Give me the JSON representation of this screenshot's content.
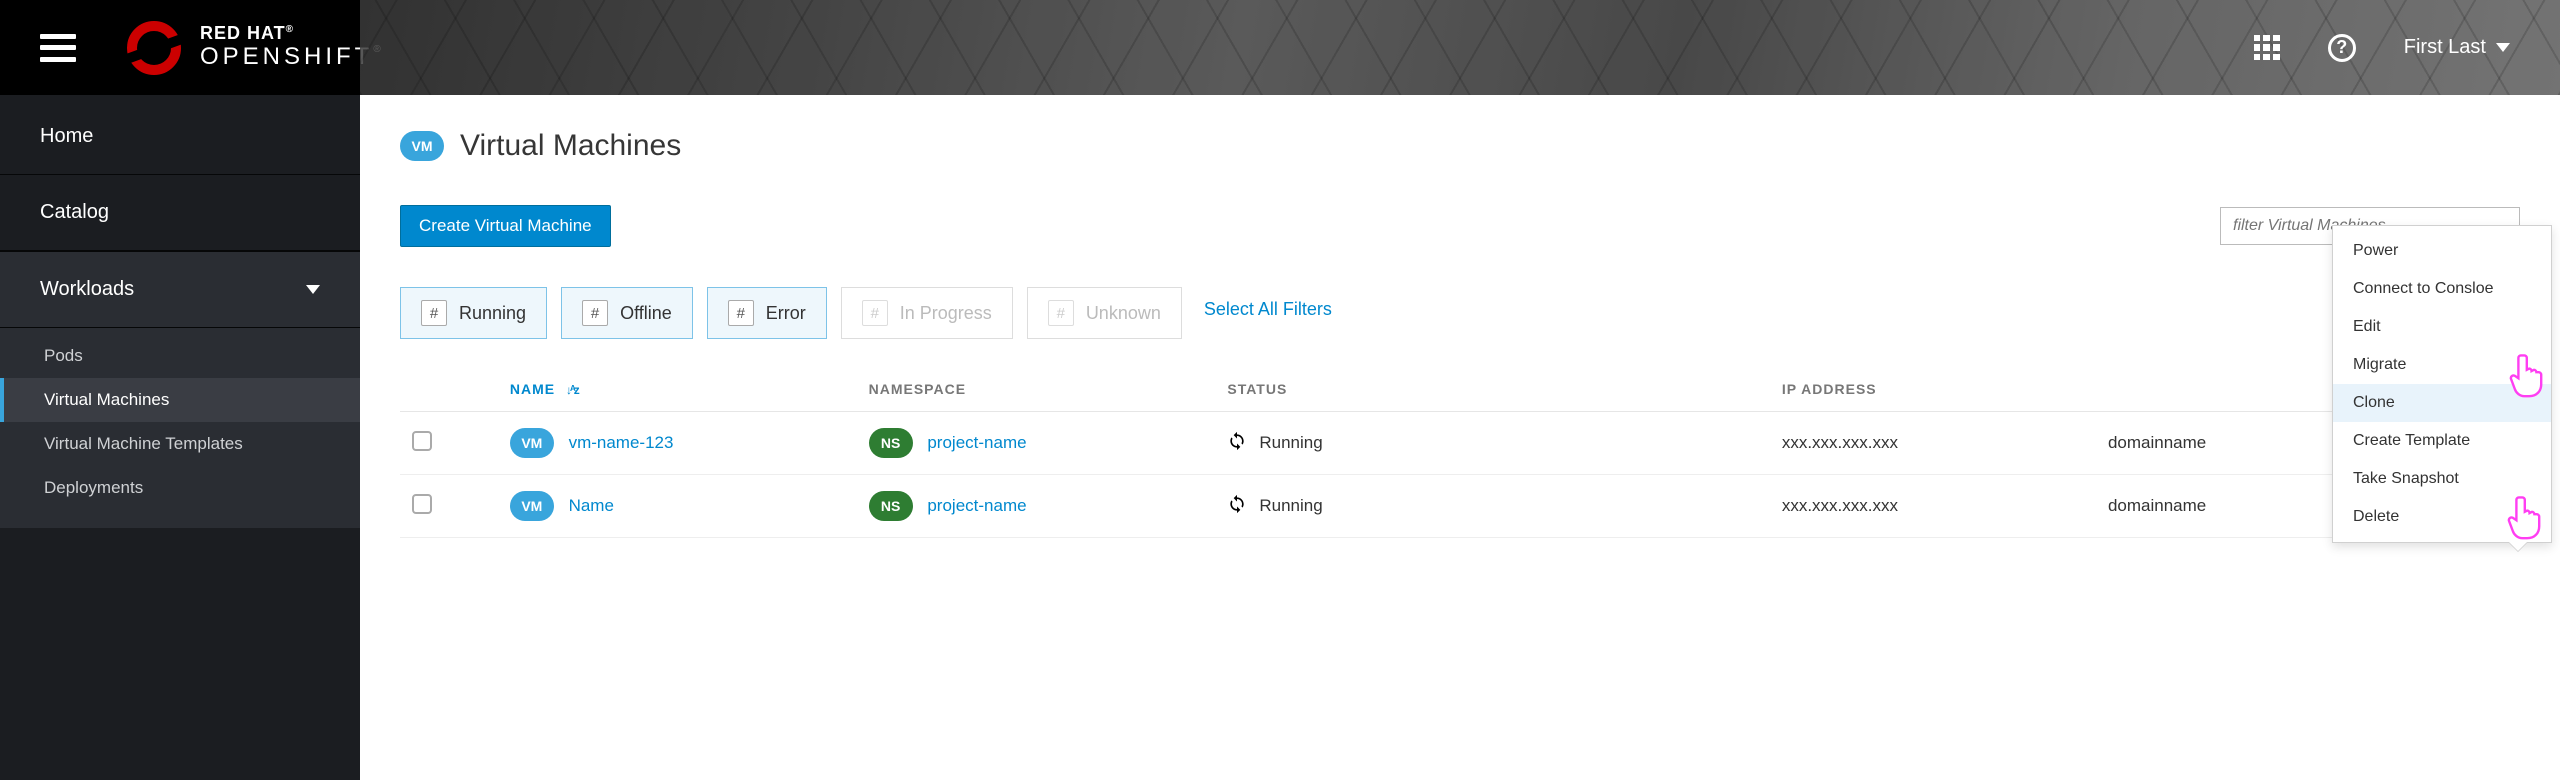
{
  "brand": {
    "line1": "RED HAT",
    "line2": "OPENSHIFT"
  },
  "topbar": {
    "user_name": "First Last"
  },
  "sidebar": {
    "items": [
      {
        "label": "Home"
      },
      {
        "label": "Catalog"
      }
    ],
    "group": {
      "label": "Workloads"
    },
    "sub_items": [
      {
        "label": "Pods"
      },
      {
        "label": "Virtual Machines"
      },
      {
        "label": "Virtual Machine Templates"
      },
      {
        "label": "Deployments"
      }
    ]
  },
  "page": {
    "badge": "VM",
    "title": "Virtual Machines",
    "create_button": "Create Virtual Machine",
    "filter_placeholder": "filter Virtual Machines"
  },
  "filters": {
    "chips": [
      {
        "count": "#",
        "label": "Running"
      },
      {
        "count": "#",
        "label": "Offline"
      },
      {
        "count": "#",
        "label": "Error"
      },
      {
        "count": "#",
        "label": "In Progress"
      },
      {
        "count": "#",
        "label": "Unknown"
      }
    ],
    "select_all": "Select All Filters"
  },
  "table": {
    "headers": {
      "name": "NAME",
      "namespace": "NAMESPACE",
      "status": "STATUS",
      "ip": "IP ADDRESS",
      "domain": ""
    },
    "rows": [
      {
        "vm_badge": "VM",
        "name": "vm-name-123",
        "ns_badge": "NS",
        "namespace": "project-name",
        "status": "Running",
        "ip": "xxx.xxx.xxx.xxx",
        "domain": "domainname"
      },
      {
        "vm_badge": "VM",
        "name": "Name",
        "ns_badge": "NS",
        "namespace": "project-name",
        "status": "Running",
        "ip": "xxx.xxx.xxx.xxx",
        "domain": "domainname"
      }
    ]
  },
  "context_menu": {
    "items": [
      "Power",
      "Connect to Consloe",
      "Edit",
      "Migrate",
      "Clone",
      "Create Template",
      "Take Snapshot",
      "Delete"
    ],
    "hover_index": 4
  }
}
